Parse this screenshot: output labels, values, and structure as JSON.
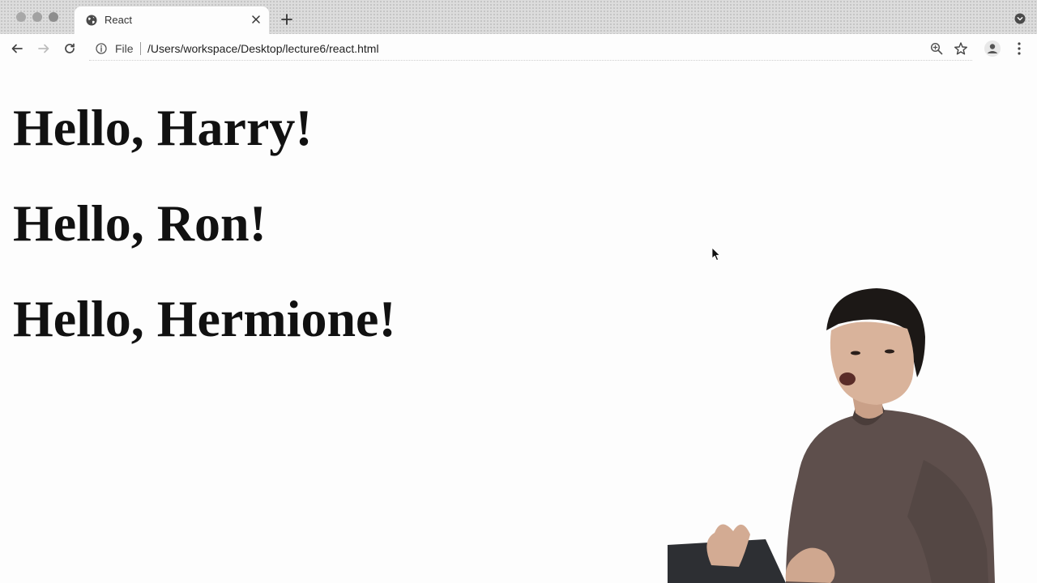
{
  "browser": {
    "tab": {
      "title": "React",
      "favicon": "globe-icon"
    },
    "toolbar": {
      "scheme_label": "File",
      "url": "/Users/workspace/Desktop/lecture6/react.html"
    }
  },
  "page": {
    "greetings": [
      "Hello, Harry!",
      "Hello, Ron!",
      "Hello, Hermione!"
    ]
  },
  "colors": {
    "tabstrip_bg": "#dcdcdc",
    "page_bg": "#fdfdfd",
    "heading_text": "#111111"
  }
}
